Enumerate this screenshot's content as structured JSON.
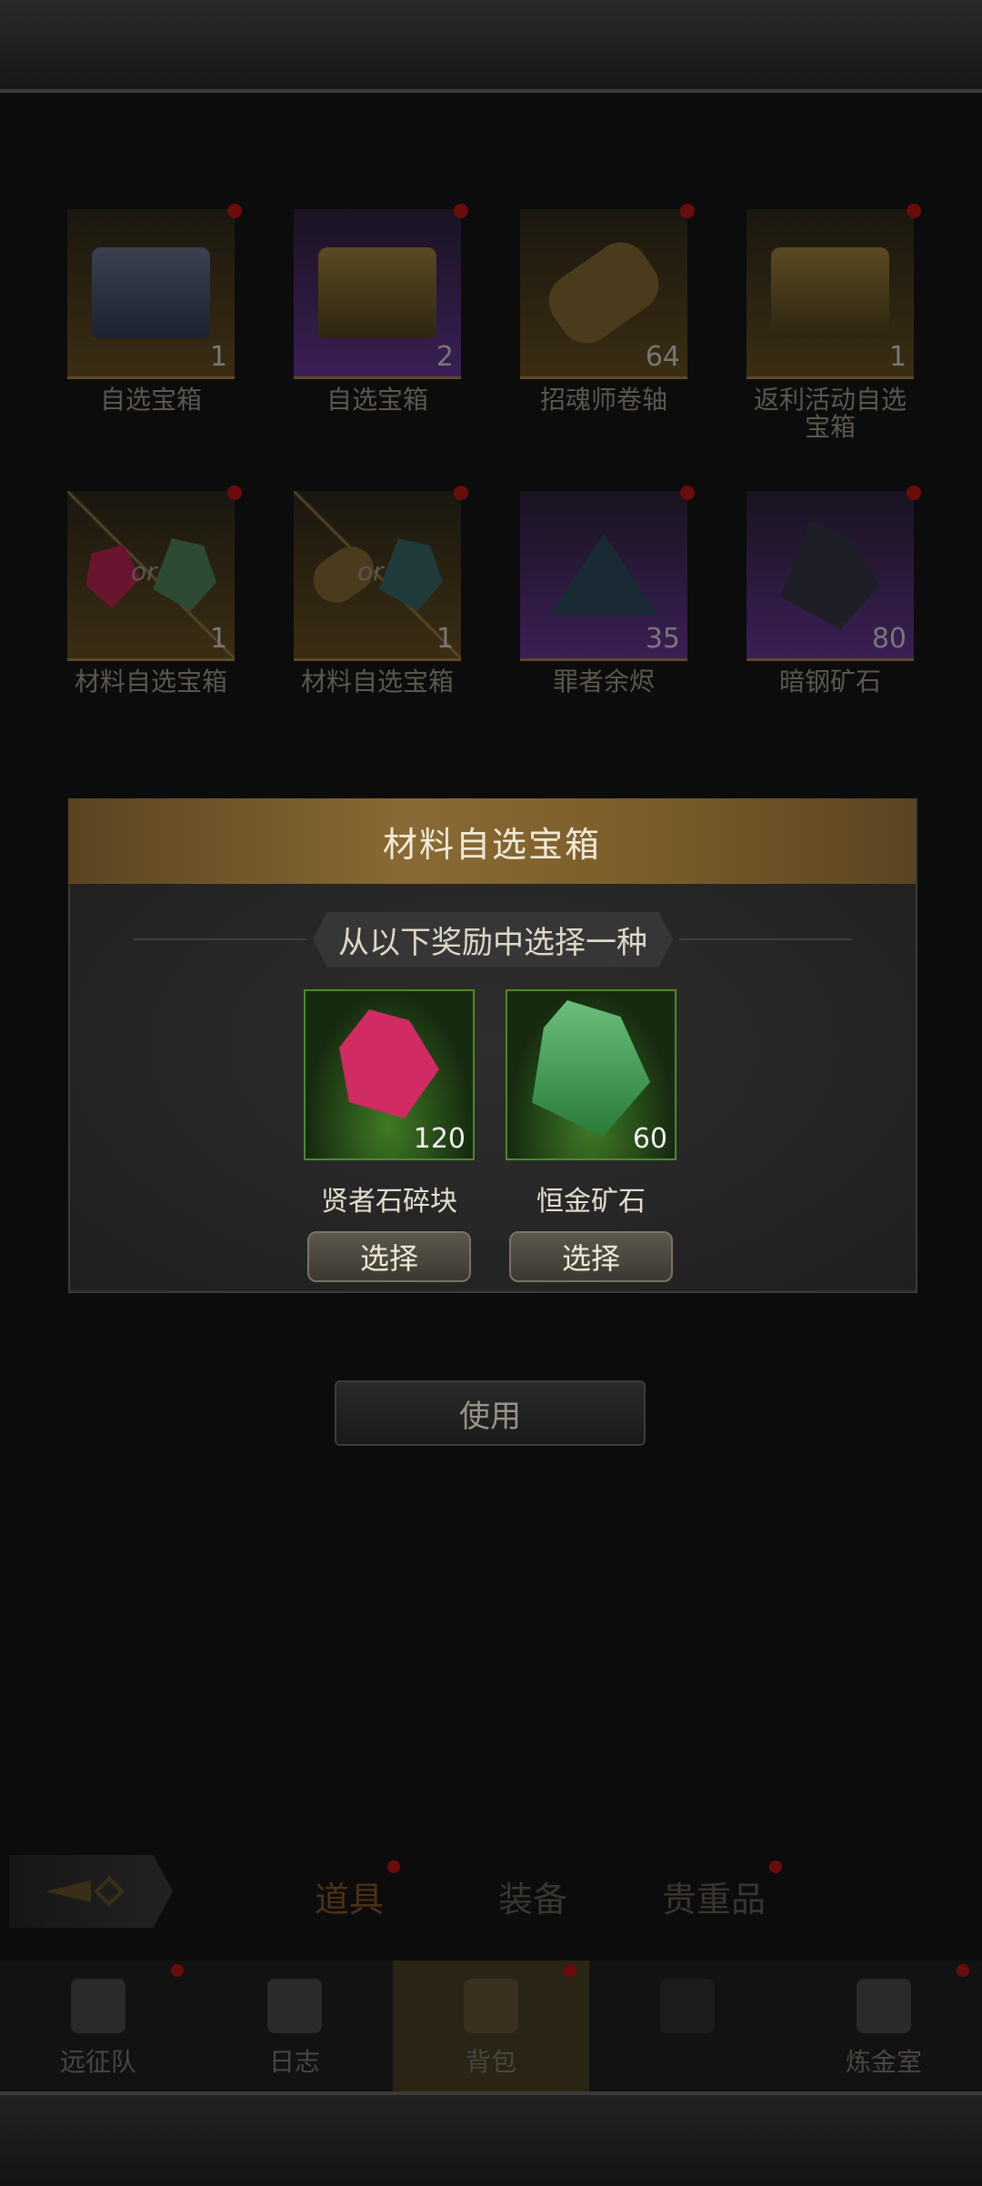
{
  "grid": {
    "items": [
      {
        "name": "自选宝箱",
        "qty": "1"
      },
      {
        "name": "自选宝箱",
        "qty": "2"
      },
      {
        "name": "招魂师卷轴",
        "qty": "64"
      },
      {
        "name": "返利活动自选宝箱",
        "qty": "1"
      },
      {
        "name": "材料自选宝箱",
        "qty": "1"
      },
      {
        "name": "材料自选宝箱",
        "qty": "1"
      },
      {
        "name": "罪者余烬",
        "qty": "35"
      },
      {
        "name": "暗钢矿石",
        "qty": "80"
      }
    ],
    "or_label": "or"
  },
  "dialog": {
    "title": "材料自选宝箱",
    "subtitle": "从以下奖励中选择一种",
    "rewards": [
      {
        "name": "贤者石碎块",
        "qty": "120",
        "button": "选择"
      },
      {
        "name": "恒金矿石",
        "qty": "60",
        "button": "选择"
      }
    ]
  },
  "use_button": "使用",
  "tabs": [
    "道具",
    "装备",
    "贵重品"
  ],
  "nav": [
    "远征队",
    "日志",
    "背包",
    "",
    "炼金室"
  ],
  "colors": {
    "accent_gold": "#8a6a34",
    "reward_green": "#4c8a2a",
    "badge_red": "#6b0c0c"
  }
}
